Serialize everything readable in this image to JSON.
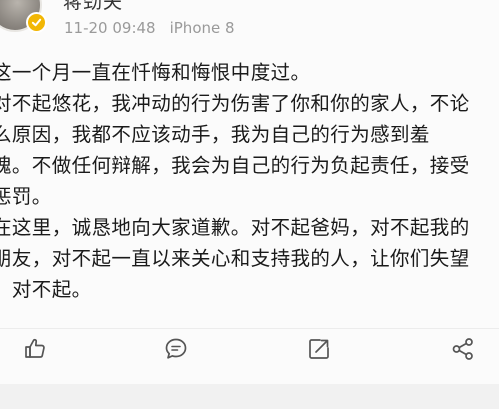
{
  "post": {
    "username": "蒋劲夫",
    "timestamp": "11-20 09:48",
    "device": "iPhone 8",
    "lines": [
      "这一个月一直在忏悔和悔恨中度过。",
      "对不起悠花，我冲动的行为伤害了你和你的家人，不论",
      "么原因，我都不应该动手，我为自己的行为感到羞",
      "愧。不做任何辩解，我会为自己的行为负起责任，接受",
      "惩罚。",
      "在这里，诚恳地向大家道歉。对不起爸妈，对不起我的",
      "朋友，对不起一直以来关心和支持我的人，让你们失望",
      "，对不起。"
    ]
  },
  "actions": {
    "like_icon": "thumbs-up-icon",
    "comment_icon": "comment-icon",
    "repost_icon": "repost-icon",
    "share_icon": "share-icon"
  },
  "colors": {
    "verify_badge": "#f2b705",
    "meta_text": "#9a9a9a",
    "body_text": "#1a1a1a"
  }
}
